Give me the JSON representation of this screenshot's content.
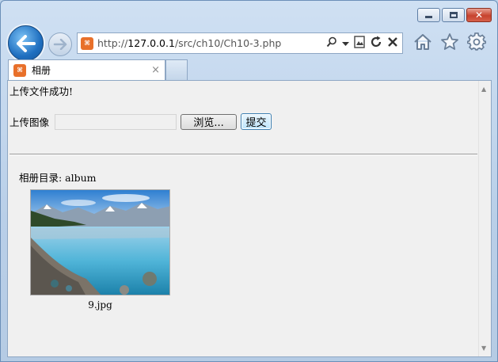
{
  "browser": {
    "url_scheme": "http://",
    "url_host": "127.0.0.1",
    "url_path": "/src/ch10/Ch10-3.php",
    "tab_title": "相册",
    "tab_close": "×",
    "favicon_letter": "⌘"
  },
  "window_controls": {
    "minimize": "",
    "maximize": "",
    "close": "✕"
  },
  "page": {
    "success_message": "上传文件成功!",
    "upload_label": "上传图像",
    "browse_button": "浏览...",
    "submit_button": "提交",
    "album_title": "相册目录: album",
    "images": [
      {
        "filename": "9.jpg"
      }
    ]
  },
  "colors": {
    "accent": "#1f6fc0",
    "favicon": "#e8702a",
    "close_button": "#c7432e"
  }
}
